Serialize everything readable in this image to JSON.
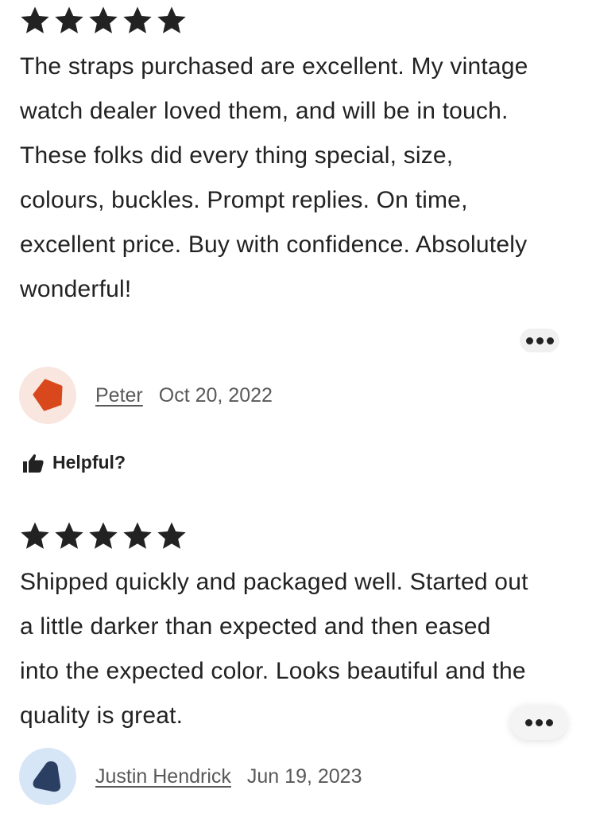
{
  "reviews": [
    {
      "rating": 5,
      "text": "The straps purchased are excellent. My vintage watch dealer loved them, and will be in touch. These folks did every thing special, size, colours, buckles. Prompt replies. On time, excellent price. Buy with confidence. Absolutely wonderful!",
      "reviewer": "Peter",
      "date": "Oct 20, 2022",
      "avatar": {
        "shape": "pentagon",
        "color": "#d9481c",
        "background": "#f8e6df"
      },
      "helpful_label": "Helpful?"
    },
    {
      "rating": 5,
      "text": "Shipped quickly and packaged well. Started out a little darker than expected and then eased into the expected color. Looks beautiful and the quality is great.",
      "reviewer": "Justin Hendrick",
      "date": "Jun 19, 2023",
      "avatar": {
        "shape": "rounded-triangle",
        "color": "#2b3f63",
        "background": "#d7e6f7"
      }
    }
  ],
  "icons": {
    "star": "star-icon",
    "more": "more-options-icon",
    "helpful": "thumbs-up-icon"
  }
}
